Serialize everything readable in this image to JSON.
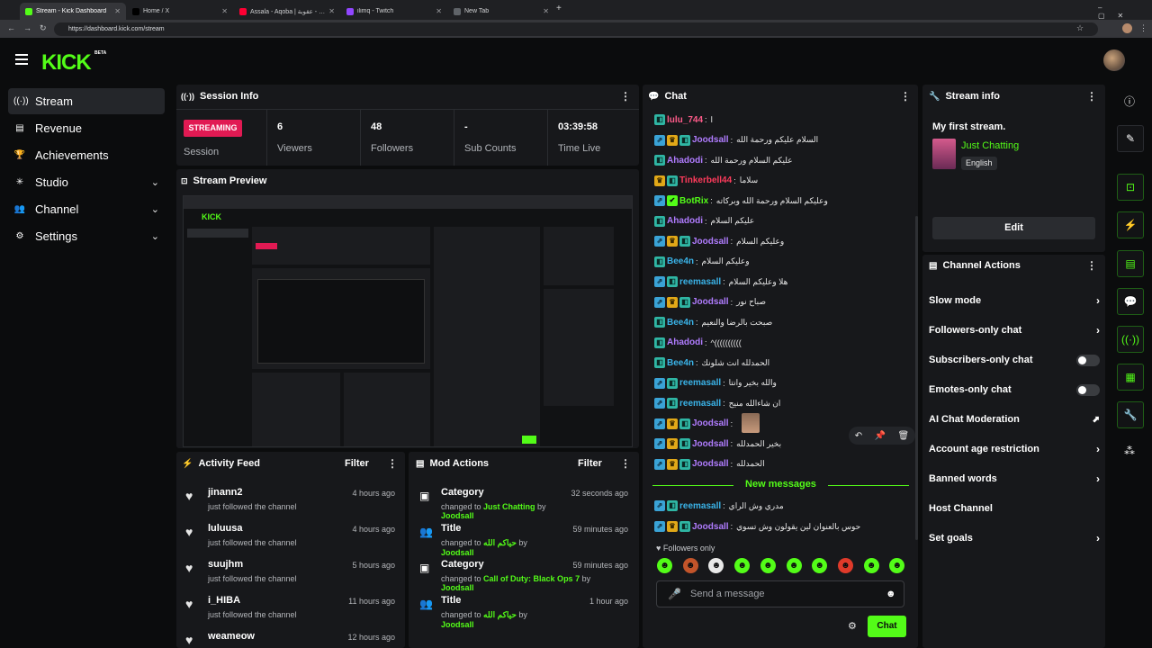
{
  "browser": {
    "tabs": [
      {
        "label": "Stream - Kick Dashboard",
        "fav": "#53fc18"
      },
      {
        "label": "Home / X",
        "fav": "#000000"
      },
      {
        "label": "Assala - Aqoba | اصالة - عقوبة",
        "fav": "#ff0033"
      },
      {
        "label": "ilimq - Twitch",
        "fav": "#9146ff"
      },
      {
        "label": "New Tab",
        "fav": "#5f6368"
      }
    ],
    "url": "https://dashboard.kick.com/stream"
  },
  "header": {
    "logo": "KICK",
    "beta": "BETA"
  },
  "sidebar": [
    {
      "icon": "((·))",
      "label": "Stream",
      "active": true
    },
    {
      "icon": "▤",
      "label": "Revenue"
    },
    {
      "icon": "🏆",
      "label": "Achievements"
    },
    {
      "icon": "✳",
      "label": "Studio",
      "chev": "⌄"
    },
    {
      "icon": "👥",
      "label": "Channel",
      "chev": "⌄"
    },
    {
      "icon": "⚙",
      "label": "Settings",
      "chev": "⌄"
    }
  ],
  "session": {
    "title": "Session Info",
    "badge": "STREAMING",
    "badge_label": "Session",
    "stats": [
      {
        "value": "6",
        "label": "Viewers"
      },
      {
        "value": "48",
        "label": "Followers"
      },
      {
        "value": "-",
        "label": "Sub Counts"
      },
      {
        "value": "03:39:58",
        "label": "Time Live"
      }
    ]
  },
  "preview": {
    "title": "Stream Preview"
  },
  "activity": {
    "title": "Activity Feed",
    "filter": "Filter",
    "items": [
      {
        "name": "jinann2",
        "sub": "just followed the channel",
        "time": "4 hours ago"
      },
      {
        "name": "luluusa",
        "sub": "just followed the channel",
        "time": "4 hours ago"
      },
      {
        "name": "suujhm",
        "sub": "just followed the channel",
        "time": "5 hours ago"
      },
      {
        "name": "i_HIBA",
        "sub": "just followed the channel",
        "time": "11 hours ago"
      },
      {
        "name": "weameow",
        "sub": "",
        "time": "12 hours ago"
      }
    ]
  },
  "mod": {
    "title": "Mod Actions",
    "filter": "Filter",
    "items": [
      {
        "icon": "▣",
        "title": "Category",
        "pre": "changed to ",
        "val": "Just Chatting",
        "mid": " by ",
        "user": "Joodsall",
        "time": "32 seconds ago"
      },
      {
        "icon": "👥",
        "title": "Title",
        "pre": "changed to ",
        "val": "حياكم الله",
        "mid": " by ",
        "user": "Joodsall",
        "time": "59 minutes ago"
      },
      {
        "icon": "▣",
        "title": "Category",
        "pre": "changed to ",
        "val": "Call of Duty: Black Ops 7",
        "mid": " by ",
        "user": "Joodsall",
        "time": "59 minutes ago"
      },
      {
        "icon": "👥",
        "title": "Title",
        "pre": "changed to ",
        "val": "حياكم الله",
        "mid": " by ",
        "user": "Joodsall",
        "time": "1 hour ago"
      }
    ]
  },
  "chat": {
    "title": "Chat",
    "messages": [
      {
        "b": [
          "teal"
        ],
        "user": "lulu_744",
        "color": "#ff5b8a",
        "text": "ا"
      },
      {
        "b": [
          "blue",
          "gold",
          "teal"
        ],
        "user": "Joodsall",
        "color": "#b07cff",
        "text": "السلام عليكم ورحمة الله"
      },
      {
        "b": [
          "teal"
        ],
        "user": "Ahadodi",
        "color": "#b07cff",
        "text": "عليكم السلام ورحمة الله"
      },
      {
        "b": [
          "gold",
          "teal"
        ],
        "user": "Tinkerbell44",
        "color": "#ff3b5c",
        "text": "سلاما"
      },
      {
        "b": [
          "blue",
          "green"
        ],
        "user": "BotRix",
        "color": "#53fc18",
        "text": "وعليكم السلام ورحمة الله وبركاته"
      },
      {
        "b": [
          "teal"
        ],
        "user": "Ahadodi",
        "color": "#b07cff",
        "text": "عليكم السلام"
      },
      {
        "b": [
          "blue",
          "gold",
          "teal"
        ],
        "user": "Joodsall",
        "color": "#b07cff",
        "text": "وعليكم السلام"
      },
      {
        "b": [
          "teal"
        ],
        "user": "Bee4n",
        "color": "#3ab3e8",
        "text": "وعليكم السلام"
      },
      {
        "b": [
          "blue",
          "teal"
        ],
        "user": "reemasall",
        "color": "#3ab3e8",
        "text": "هلا وعليكم السلام"
      },
      {
        "b": [
          "blue",
          "gold",
          "teal"
        ],
        "user": "Joodsall",
        "color": "#b07cff",
        "text": "صباح نور"
      },
      {
        "b": [
          "teal"
        ],
        "user": "Bee4n",
        "color": "#3ab3e8",
        "text": "صبحت بالرضا والنعيم"
      },
      {
        "b": [
          "teal"
        ],
        "user": "Ahadodi",
        "color": "#b07cff",
        "text": "^(((((((((("
      },
      {
        "b": [
          "teal"
        ],
        "user": "Bee4n",
        "color": "#3ab3e8",
        "text": "الحمدلله انت شلونك"
      },
      {
        "b": [
          "blue",
          "teal"
        ],
        "user": "reemasall",
        "color": "#3ab3e8",
        "text": "والله بخير وانتا"
      },
      {
        "b": [
          "blue",
          "teal"
        ],
        "user": "reemasall",
        "color": "#3ab3e8",
        "text": "ان شاءالله منيح"
      },
      {
        "b": [
          "blue",
          "gold",
          "teal"
        ],
        "user": "Joodsall",
        "color": "#b07cff",
        "text": ""
      },
      {
        "b": [
          "blue",
          "gold",
          "teal"
        ],
        "user": "Joodsall",
        "color": "#b07cff",
        "text": "بخير الحمدلله"
      },
      {
        "b": [
          "blue",
          "gold",
          "teal"
        ],
        "user": "Joodsall",
        "color": "#b07cff",
        "text": "الحمدلله"
      }
    ],
    "new_label": "New messages",
    "new": [
      {
        "b": [
          "blue",
          "teal"
        ],
        "user": "reemasall",
        "color": "#3ab3e8",
        "text": "مدري وش الراي"
      },
      {
        "b": [
          "blue",
          "gold",
          "teal"
        ],
        "user": "Joodsall",
        "color": "#b07cff",
        "text": "حوس بالعنوان لين يقولون وش تسوي"
      }
    ],
    "followers_only": "Followers only",
    "placeholder": "Send a message",
    "send": "Chat"
  },
  "stream_info": {
    "title": "Stream info",
    "stream_title": "My first stream.",
    "category": "Just Chatting",
    "language": "English",
    "edit": "Edit"
  },
  "channel_actions": {
    "title": "Channel Actions",
    "items": [
      {
        "label": "Slow mode",
        "type": "arrow"
      },
      {
        "label": "Followers-only chat",
        "type": "arrow"
      },
      {
        "label": "Subscribers-only chat",
        "type": "toggle"
      },
      {
        "label": "Emotes-only chat",
        "type": "toggle"
      },
      {
        "label": "AI Chat Moderation",
        "type": "ext"
      },
      {
        "label": "Account age restriction",
        "type": "arrow"
      },
      {
        "label": "Banned words",
        "type": "arrow"
      },
      {
        "label": "Host Channel",
        "type": "none"
      },
      {
        "label": "Set goals",
        "type": "arrow"
      }
    ]
  }
}
